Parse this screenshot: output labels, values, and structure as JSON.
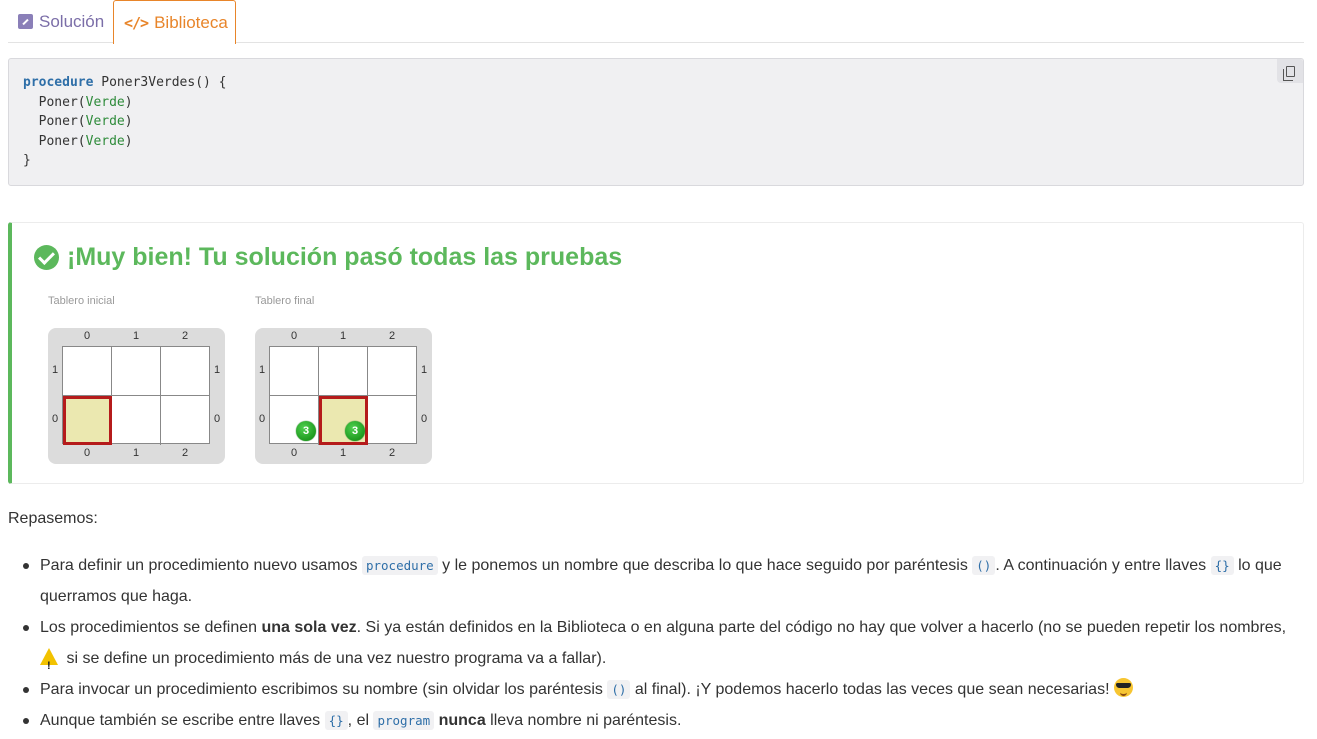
{
  "tabs": {
    "solution_label": "Solución",
    "library_label": "Biblioteca"
  },
  "code": {
    "keyword": "procedure",
    "signature": " Poner3Verdes() {",
    "call": "Poner(",
    "color_arg": "Verde",
    "close_paren": ")",
    "close_brace": "}",
    "indent": "  "
  },
  "result": {
    "title": "¡Muy bien! Tu solución pasó todas las pruebas",
    "status_color": "#5cb85c",
    "initial_board": {
      "label": "Tablero inicial",
      "columns": [
        "0",
        "1",
        "2"
      ],
      "rows": [
        "1",
        "0"
      ],
      "head_cell": "0,0",
      "balls": []
    },
    "final_board": {
      "label": "Tablero final",
      "columns": [
        "0",
        "1",
        "2"
      ],
      "rows": [
        "1",
        "0"
      ],
      "head_cell": "1,0",
      "balls": [
        {
          "cell": "0,0",
          "color": "green",
          "count": "3"
        },
        {
          "cell": "1,0",
          "color": "green",
          "count": "3"
        }
      ]
    }
  },
  "review": {
    "intro": "Repasemos:",
    "items": {
      "i1_a": "Para definir un procedimiento nuevo usamos ",
      "i1_code1": "procedure",
      "i1_b": " y le ponemos un nombre que describa lo que hace seguido por paréntesis ",
      "i1_code2": "()",
      "i1_c": ". A continuación y entre llaves ",
      "i1_code3": "{}",
      "i1_d": " lo que querramos que haga.",
      "i2_a": "Los procedimientos se definen ",
      "i2_bold": "una sola vez",
      "i2_b": ". Si ya están definidos en la Biblioteca o en alguna parte del código no hay que volver a hacerlo (no se pueden repetir los nombres, ",
      "i2_c": " si se define un procedimiento más de una vez nuestro programa va a fallar).",
      "i3_a": "Para invocar un procedimiento escribimos su nombre (sin olvidar los paréntesis ",
      "i3_code": "()",
      "i3_b": " al final). ¡Y podemos hacerlo todas las veces que sean necesarias! ",
      "i4_a": "Aunque también se escribe entre llaves ",
      "i4_code1": "{}",
      "i4_b": ", el ",
      "i4_code2": "program",
      "i4_c": " ",
      "i4_bold": "nunca",
      "i4_d": " lleva nombre ni paréntesis."
    }
  }
}
